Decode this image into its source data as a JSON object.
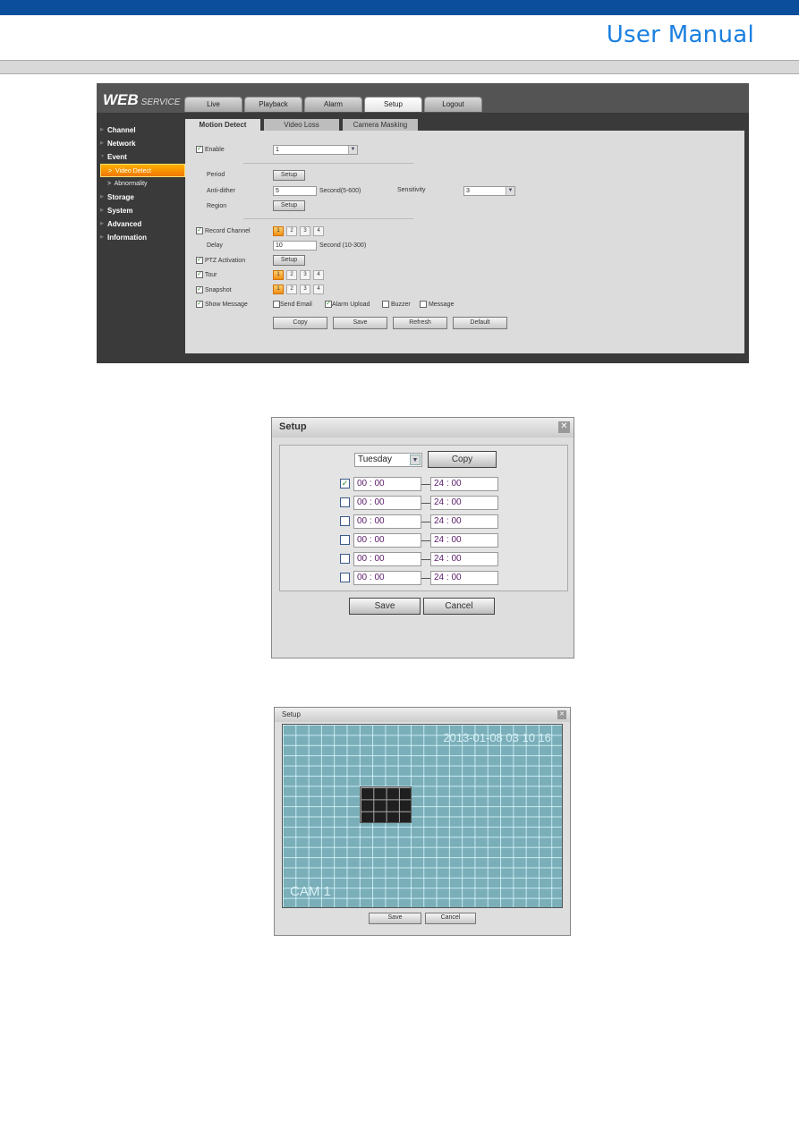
{
  "header": {
    "title": "User Manual",
    "colors": {
      "bar": "#0b4f9c",
      "title": "#1a7fe0"
    }
  },
  "web_service": {
    "logo": "WEB",
    "logo_sub": "SERVICE",
    "main_tabs": [
      "Live",
      "Playback",
      "Alarm",
      "Setup",
      "Logout"
    ],
    "active_main_tab": "Setup",
    "sidebar": {
      "items": [
        "Channel",
        "Network",
        "Event",
        "Storage",
        "System",
        "Advanced",
        "Information"
      ],
      "event_sub": [
        "Video Detect",
        "Abnormality"
      ],
      "active_sub": "Video Detect"
    },
    "sub_tabs": [
      "Motion Detect",
      "Video Loss",
      "Camera Masking"
    ],
    "active_sub_tab": "Motion Detect",
    "form": {
      "enable_label": "Enable",
      "enable_checked": true,
      "channel_value": "1",
      "period_label": "Period",
      "setup_label": "Setup",
      "anti_dither_label": "Anti-dither",
      "anti_dither_value": "5",
      "anti_dither_unit": "Second(5-600)",
      "sensitivity_label": "Sensitivity",
      "sensitivity_value": "3",
      "region_label": "Region",
      "record_channel_label": "Record Channel",
      "channels": [
        "1",
        "2",
        "3",
        "4"
      ],
      "delay_label": "Delay",
      "delay_value": "10",
      "delay_unit": "Second (10-300)",
      "ptz_label": "PTZ Activation",
      "tour_label": "Tour",
      "snapshot_label": "Snapshot",
      "show_message_label": "Show Message",
      "send_email_label": "Send Email",
      "alarm_upload_label": "Alarm Upload",
      "buzzer_label": "Buzzer",
      "message_label": "Message",
      "buttons": [
        "Copy",
        "Save",
        "Refresh",
        "Default"
      ]
    }
  },
  "period_dialog": {
    "title": "Setup",
    "day": "Tuesday",
    "copy_label": "Copy",
    "periods": [
      {
        "checked": true,
        "start": "00 : 00",
        "end": "24 : 00"
      },
      {
        "checked": false,
        "start": "00 : 00",
        "end": "24 : 00"
      },
      {
        "checked": false,
        "start": "00 : 00",
        "end": "24 : 00"
      },
      {
        "checked": false,
        "start": "00 : 00",
        "end": "24 : 00"
      },
      {
        "checked": false,
        "start": "00 : 00",
        "end": "24 : 00"
      },
      {
        "checked": false,
        "start": "00 : 00",
        "end": "24 : 00"
      }
    ],
    "save_label": "Save",
    "cancel_label": "Cancel"
  },
  "region_dialog": {
    "title": "Setup",
    "timestamp": "2013-01-08 03 10 16",
    "camera_label": "CAM 1",
    "save_label": "Save",
    "cancel_label": "Cancel"
  }
}
